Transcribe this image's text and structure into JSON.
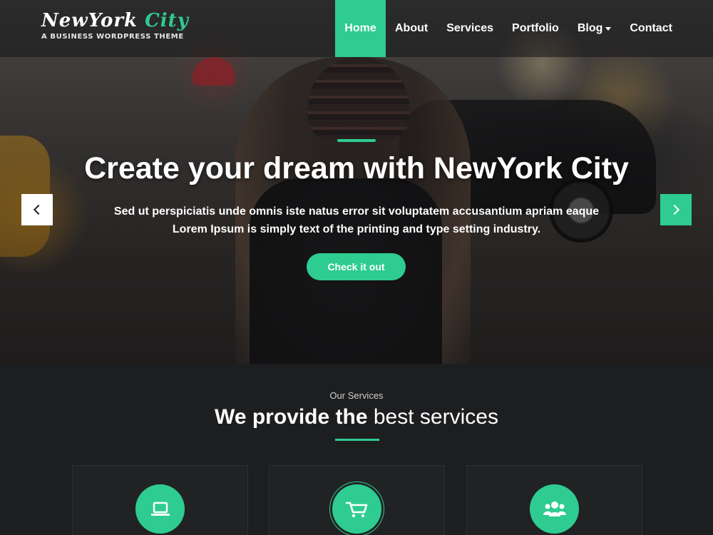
{
  "header": {
    "logo_part1": "NewYork",
    "logo_part2": "City",
    "tagline": "A BUSINESS WORDPRESS THEME",
    "nav": [
      {
        "label": "Home",
        "active": true
      },
      {
        "label": "About"
      },
      {
        "label": "Services"
      },
      {
        "label": "Portfolio"
      },
      {
        "label": "Blog",
        "has_dropdown": true
      },
      {
        "label": "Contact"
      }
    ]
  },
  "slider": {
    "title": "Create your dream with NewYork City",
    "description_line1": "Sed ut perspiciatis unde omnis iste natus error sit voluptatem accusantium apriam eaque",
    "description_line2": "Lorem Ipsum is simply text of the printing and type setting industry.",
    "cta_label": "Check it out",
    "prev_icon": "chevron-left-icon",
    "next_icon": "chevron-right-icon"
  },
  "services": {
    "kicker": "Our Services",
    "heading_strong": "We provide the",
    "heading_light": "best services",
    "cards": [
      {
        "icon": "laptop-icon"
      },
      {
        "icon": "shopping-cart-icon"
      },
      {
        "icon": "users-icon"
      }
    ]
  },
  "colors": {
    "accent": "#2ecc91",
    "dark_bg": "#1d1e20",
    "card_bg": "#212224"
  }
}
